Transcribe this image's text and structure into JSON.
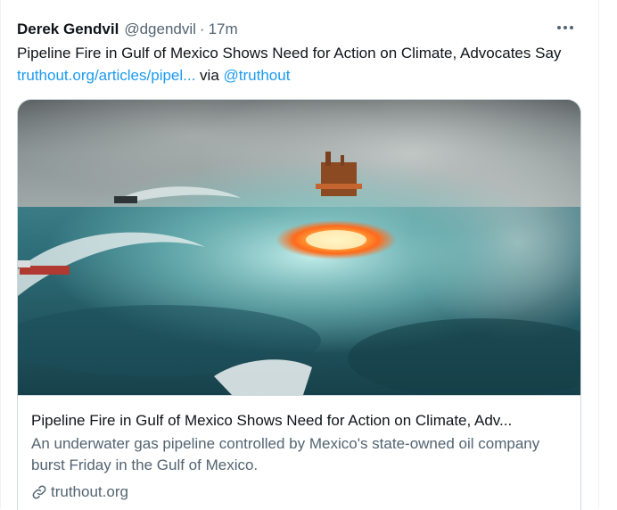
{
  "tweet": {
    "author_name": "Derek Gendvil",
    "author_handle": "@dgendvil",
    "separator": "·",
    "timestamp": "17m",
    "text_main": "Pipeline Fire in Gulf of Mexico Shows Need for Action on Climate, Advocates Say ",
    "link_text": "truthout.org/articles/pipel...",
    "via_text": " via ",
    "mention": "@truthout"
  },
  "card": {
    "title": "Pipeline Fire in Gulf of Mexico Shows Need for Action on Climate, Adv...",
    "description": "An underwater gas pipeline controlled by Mexico's state-owned oil company burst Friday in the Gulf of Mexico.",
    "domain": "truthout.org"
  },
  "colors": {
    "link": "#1d9bf0",
    "secondary_text": "#536471",
    "border": "#cfd9de"
  },
  "icons": {
    "more": "more-horizontal-icon",
    "link": "link-chain-icon"
  }
}
